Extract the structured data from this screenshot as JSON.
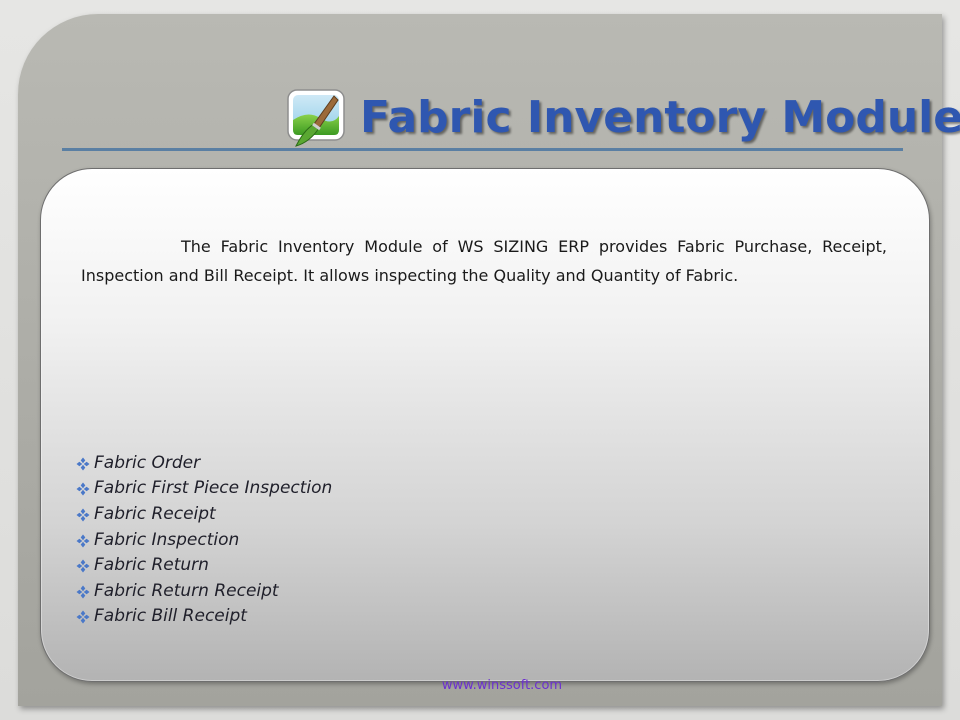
{
  "slide": {
    "title": "Fabric Inventory Module",
    "intro": "The Fabric Inventory Module of WS SIZING ERP provides Fabric Purchase, Receipt, Inspection and Bill Receipt. It allows inspecting the Quality and Quantity of Fabric.",
    "bullets": [
      "Fabric Order",
      "Fabric First Piece Inspection",
      "Fabric Receipt",
      "Fabric Inspection",
      "Fabric Return",
      "Fabric Return Receipt",
      "Fabric Bill Receipt"
    ],
    "footer": "www.winssoft.com"
  },
  "icons": {
    "title_icon": "paint-brush-on-landscape-icon",
    "bullet_icon": "four-diamond-bullet-icon"
  },
  "colors": {
    "title": "#2f57b0",
    "rule": "#5a7fa3",
    "footer": "#6c2fd0",
    "bullet": "#4a78c8"
  }
}
